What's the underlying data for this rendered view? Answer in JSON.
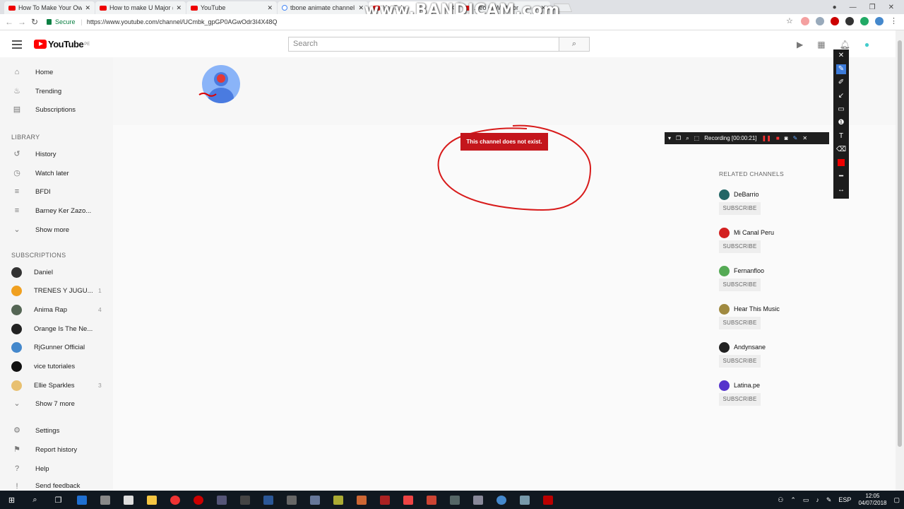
{
  "browser": {
    "tabs": [
      {
        "label": "How To Make Your Own",
        "favicon": "youtube-favicon"
      },
      {
        "label": "How to make U Major (F",
        "favicon": "youtube-favicon"
      },
      {
        "label": "YouTube",
        "favicon": "youtube-favicon"
      },
      {
        "label": "tbone animate channel -",
        "favicon": "google-favicon"
      },
      {
        "label": "YouTube",
        "favicon": "youtube-favicon"
      },
      {
        "label": "...eo in W Major",
        "favicon": "youtube-favicon"
      }
    ],
    "close_glyph": "✕",
    "secure_label": "Secure",
    "url": "https://www.youtube.com/channel/UCmbk_gpGP0AGwOdr3I4X48Q"
  },
  "watermark": "www.BANDICAM.com",
  "header": {
    "logo_text": "YouTube",
    "logo_region": "PE",
    "search_placeholder": "Search"
  },
  "sidebar": {
    "main": [
      {
        "label": "Home",
        "icon": "home-icon"
      },
      {
        "label": "Trending",
        "icon": "flame-icon"
      },
      {
        "label": "Subscriptions",
        "icon": "subscriptions-icon"
      }
    ],
    "library_title": "LIBRARY",
    "library": [
      {
        "label": "History",
        "icon": "history-icon"
      },
      {
        "label": "Watch later",
        "icon": "clock-icon"
      },
      {
        "label": "BFDI",
        "icon": "playlist-icon"
      },
      {
        "label": "Barney Ker Zazo...",
        "icon": "playlist-icon"
      },
      {
        "label": "Show more",
        "icon": "chevron-down-icon"
      }
    ],
    "subscriptions_title": "SUBSCRIPTIONS",
    "subscriptions": [
      {
        "label": "Daniel",
        "count": "",
        "color": "#333333"
      },
      {
        "label": "TRENES Y JUGU...",
        "count": "1",
        "color": "#f0a020"
      },
      {
        "label": "Anima Rap",
        "count": "4",
        "color": "#556655"
      },
      {
        "label": "Orange Is The Ne...",
        "count": "",
        "color": "#222222"
      },
      {
        "label": "RjGunner Official",
        "count": "",
        "color": "#4488cc"
      },
      {
        "label": "vice tutoriales",
        "count": "",
        "color": "#111111"
      },
      {
        "label": "Ellie Sparkles",
        "count": "3",
        "color": "#e8c070"
      }
    ],
    "show_more_subs": "Show 7 more",
    "footer": [
      {
        "label": "Settings",
        "icon": "gear-icon"
      },
      {
        "label": "Report history",
        "icon": "flag-icon"
      },
      {
        "label": "Help",
        "icon": "help-icon"
      },
      {
        "label": "Send feedback",
        "icon": "feedback-icon"
      }
    ]
  },
  "channel": {
    "error_message": "This channel does not exist."
  },
  "recorder": {
    "status": "Recording [00:00:21]"
  },
  "related": {
    "title": "RELATED CHANNELS",
    "subscribe_label": "SUBSCRIBE",
    "channels": [
      {
        "name": "DeBarrio",
        "color": "#226666"
      },
      {
        "name": "Mi Canal Peru",
        "color": "#d32020"
      },
      {
        "name": "Fernanfloo",
        "color": "#55aa55"
      },
      {
        "name": "Hear This Music",
        "color": "#a08a40"
      },
      {
        "name": "Andynsane",
        "color": "#222222"
      },
      {
        "name": "Latina.pe",
        "color": "#5533cc"
      }
    ]
  },
  "taskbar": {
    "language": "ESP",
    "time": "12:05",
    "date": "04/07/2018"
  }
}
